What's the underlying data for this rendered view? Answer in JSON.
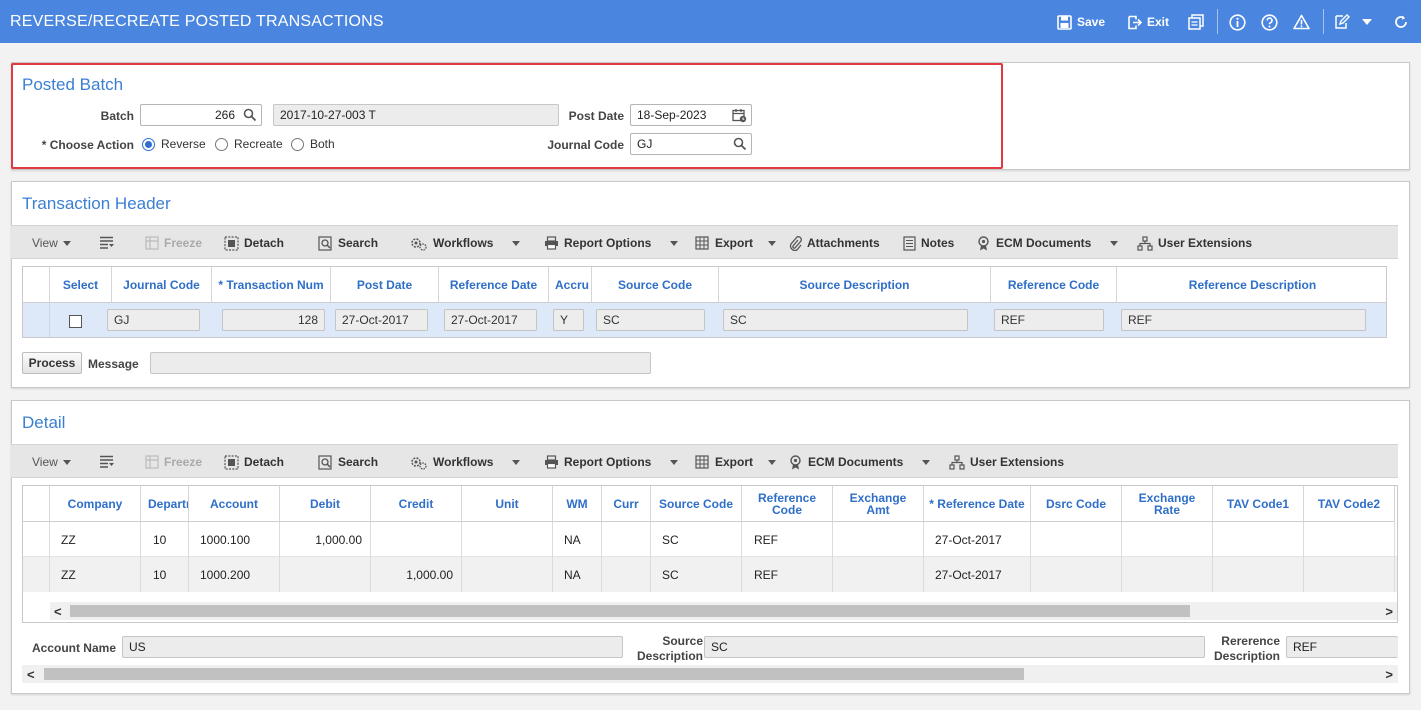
{
  "app": {
    "title": "REVERSE/RECREATE POSTED TRANSACTIONS"
  },
  "toolbar": {
    "save": "Save",
    "exit": "Exit"
  },
  "posted_batch": {
    "title": "Posted Batch",
    "batch_label": "Batch",
    "batch_value": "266",
    "batch_desc": "2017-10-27-003 T",
    "post_date_label": "Post Date",
    "post_date_value": "18-Sep-2023",
    "choose_action_label": "* Choose Action",
    "actions": [
      "Reverse",
      "Recreate",
      "Both"
    ],
    "selected_action": "Reverse",
    "journal_code_label": "Journal Code",
    "journal_code_value": "GJ"
  },
  "transaction_header": {
    "title": "Transaction Header",
    "toolbar": [
      "View",
      "Freeze",
      "Detach",
      "Search",
      "Workflows",
      "Report Options",
      "Export",
      "Attachments",
      "Notes",
      "ECM Documents",
      "User Extensions"
    ],
    "columns": [
      "Select",
      "Journal Code",
      "* Transaction Num",
      "Post Date",
      "Reference Date",
      "Accru",
      "Source Code",
      "Source Description",
      "Reference Code",
      "Reference Description"
    ],
    "row": {
      "journal_code": "GJ",
      "transaction_num": "128",
      "post_date": "27-Oct-2017",
      "reference_date": "27-Oct-2017",
      "accrual": "Y",
      "source_code": "SC",
      "source_description": "SC",
      "reference_code": "REF",
      "reference_description": "REF"
    },
    "process_button": "Process",
    "message_label": "Message",
    "message_value": ""
  },
  "detail": {
    "title": "Detail",
    "toolbar": [
      "View",
      "Freeze",
      "Detach",
      "Search",
      "Workflows",
      "Report Options",
      "Export",
      "ECM Documents",
      "User Extensions"
    ],
    "columns": [
      "Company",
      "Departr",
      "Account",
      "Debit",
      "Credit",
      "Unit",
      "WM",
      "Curr",
      "Source Code",
      "Reference Code",
      "Exchange Amt",
      "* Reference Date",
      "Dsrc Code",
      "Exchange Rate",
      "TAV Code1",
      "TAV Code2"
    ],
    "rows": [
      [
        "ZZ",
        "10",
        "1000.100",
        "1,000.00",
        "",
        "",
        "NA",
        "",
        "SC",
        "REF",
        "",
        "27-Oct-2017",
        "",
        "",
        "",
        ""
      ],
      [
        "ZZ",
        "10",
        "1000.200",
        "",
        "1,000.00",
        "",
        "NA",
        "",
        "SC",
        "REF",
        "",
        "27-Oct-2017",
        "",
        "",
        "",
        ""
      ]
    ],
    "account_name_label": "Account Name",
    "account_name_value": "US",
    "source_desc_label_1": "Source",
    "source_desc_label_2": "Description",
    "source_desc_value": "SC",
    "ref_desc_label_1": "Rererence",
    "ref_desc_label_2": "Description",
    "ref_desc_value": "REF"
  },
  "colors": {
    "titlebar": "#4a86e0",
    "section_title": "#3b7fd4",
    "column_header": "#2f6fc9",
    "highlight": "#e2383f"
  }
}
